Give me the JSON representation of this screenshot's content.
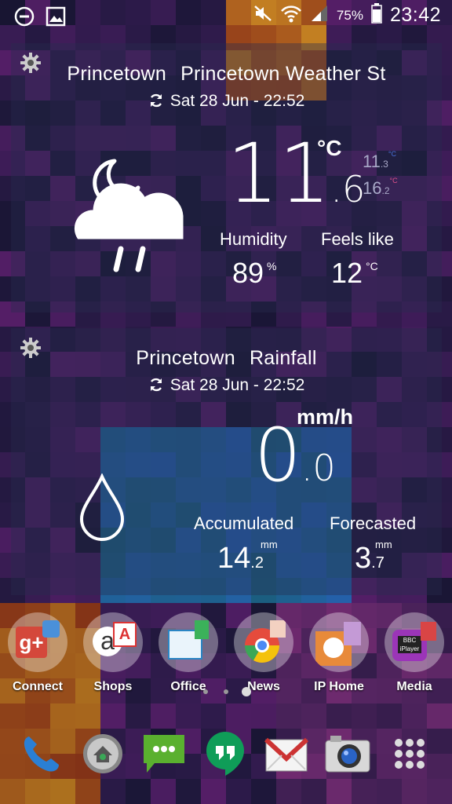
{
  "status_bar": {
    "battery": "75%",
    "time": "23:42"
  },
  "weather_widget": {
    "location": "Princetown",
    "station": "Princetown Weather St",
    "updated": "Sat 28 Jun - 22:52",
    "temp_int": "11",
    "temp_dec": ".6",
    "unit": "°C",
    "min_int": "11",
    "min_dec": ".3",
    "max_int": "16",
    "max_dec": ".2",
    "mini_unit": "°C",
    "humidity_label": "Humidity",
    "humidity_value": "89",
    "humidity_unit": "%",
    "feels_label": "Feels like",
    "feels_value": "12",
    "feels_unit": "°C",
    "icon": "night-cloud-rain-icon"
  },
  "rain_widget": {
    "location": "Princetown",
    "title": "Rainfall",
    "updated": "Sat 28 Jun - 22:52",
    "unit": "mm/h",
    "rate_int": "0",
    "rate_dec": ".0",
    "accum_label": "Accumulated",
    "accum_int": "14",
    "accum_dec": ".2",
    "accum_unit": "mm",
    "fore_label": "Forecasted",
    "fore_int": "3",
    "fore_dec": ".7",
    "fore_unit": "mm",
    "icon": "raindrop-icon"
  },
  "apps": [
    {
      "label": "Connect",
      "icon": "google-plus-folder-icon"
    },
    {
      "label": "Shops",
      "icon": "amazon-folder-icon"
    },
    {
      "label": "Office",
      "icon": "office-folder-icon"
    },
    {
      "label": "News",
      "icon": "chrome-folder-icon"
    },
    {
      "label": "IP Home",
      "icon": "ip-camera-folder-icon"
    },
    {
      "label": "Media",
      "icon": "bbc-iplayer-folder-icon"
    }
  ],
  "dock": [
    {
      "icon": "phone-icon"
    },
    {
      "icon": "home-launcher-icon"
    },
    {
      "icon": "messaging-icon"
    },
    {
      "icon": "hangouts-icon"
    },
    {
      "icon": "gmail-icon"
    },
    {
      "icon": "camera-icon"
    },
    {
      "icon": "app-drawer-icon"
    }
  ],
  "colors": {
    "min_accent": "#4a6fd8",
    "max_accent": "#e0508a",
    "widget_bg": "rgba(40,45,80,0.38)"
  }
}
